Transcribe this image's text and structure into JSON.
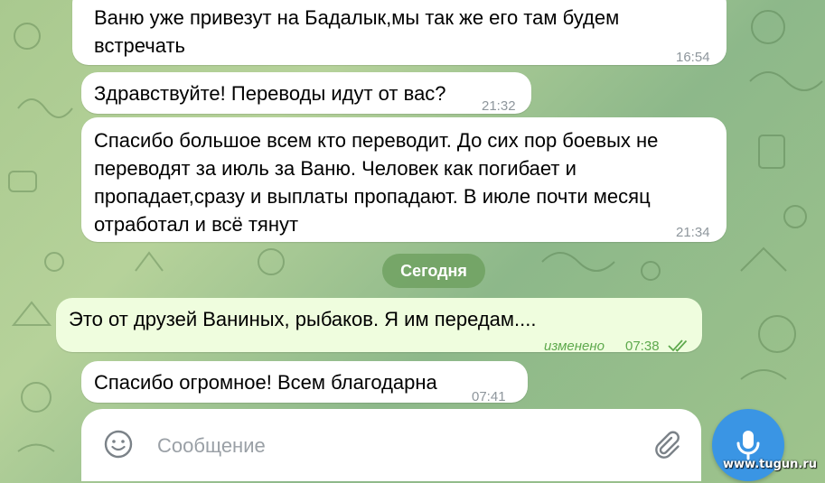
{
  "messages": [
    {
      "text": "Ваню уже привезут на Бадалык,мы так же его там будем\nвстречать",
      "time": "16:54"
    },
    {
      "text": "Здравствуйте! Переводы идут от вас?",
      "time": "21:32"
    },
    {
      "text": "Спасибо большое всем кто переводит. До сих пор боевых не\nпереводят за июль за Ваню. Человек как погибает и\nпропадает,сразу и выплаты пропадают. В июле почти месяц\nотработал и всё тянут",
      "time": "21:34"
    },
    {
      "text": "Это от друзей Ваниных, рыбаков. Я им передам....",
      "edited": "изменено",
      "time": "07:38",
      "read_icon": "double-check-icon"
    },
    {
      "text": "Спасибо огромное! Всем благодарна",
      "time": "07:41"
    }
  ],
  "date_separator": "Сегодня",
  "composer": {
    "placeholder": "Сообщение",
    "emoji_icon": "smile-icon",
    "attach_icon": "paperclip-icon",
    "send_icon": "microphone-icon"
  },
  "watermark": "www.tugun.ru",
  "colors": {
    "incoming_bubble": "#ffffff",
    "outgoing_bubble": "#effdde",
    "outgoing_meta": "#5ea94d",
    "mic_button": "#3a95e4",
    "date_pill": "#6ea05f"
  }
}
